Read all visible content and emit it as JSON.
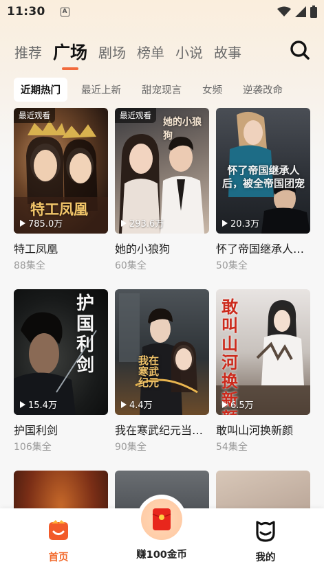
{
  "status": {
    "time": "11:30",
    "indicator": "A",
    "icons": [
      "wifi-icon",
      "signal-icon",
      "battery-icon"
    ]
  },
  "top_tabs": [
    {
      "label": "推荐",
      "active": false
    },
    {
      "label": "广场",
      "active": true
    },
    {
      "label": "剧场",
      "active": false
    },
    {
      "label": "榜单",
      "active": false
    },
    {
      "label": "小说",
      "active": false
    },
    {
      "label": "故事",
      "active": false
    }
  ],
  "sub_tabs": [
    {
      "label": "近期热门",
      "active": true
    },
    {
      "label": "最近上新",
      "active": false
    },
    {
      "label": "甜宠现言",
      "active": false
    },
    {
      "label": "女频",
      "active": false
    },
    {
      "label": "逆袭改命",
      "active": false
    }
  ],
  "dramas": [
    {
      "title": "特工凤凰",
      "episodes": "88集全",
      "plays": "785.0万",
      "badge": "最近观看",
      "poster_text": "特工凤凰"
    },
    {
      "title": "她的小狼狗",
      "episodes": "60集全",
      "plays": "293.6万",
      "badge": "最近观看",
      "poster_text": "她的小狼狗"
    },
    {
      "title": "怀了帝国继承人后，被全帝国团宠",
      "episodes": "50集全",
      "plays": "20.3万",
      "badge": "",
      "poster_text": "怀了帝国继承人后，被全帝国团宠"
    },
    {
      "title": "护国利剑",
      "episodes": "106集全",
      "plays": "15.4万",
      "badge": "",
      "poster_text": "护国利剑"
    },
    {
      "title": "我在寒武纪元当首富",
      "episodes": "90集全",
      "plays": "4.4万",
      "badge": "",
      "poster_text": "我在寒武纪元"
    },
    {
      "title": "敢叫山河换新颜",
      "episodes": "54集全",
      "plays": "6.5万",
      "badge": "",
      "poster_text": "敢叫山河换新颜"
    }
  ],
  "bottom_nav": {
    "home": "首页",
    "earn": "赚100金币",
    "me": "我的"
  },
  "colors": {
    "accent": "#f26a3c",
    "home_active": "#f26a2c",
    "earn_packet": "#e8261c"
  }
}
